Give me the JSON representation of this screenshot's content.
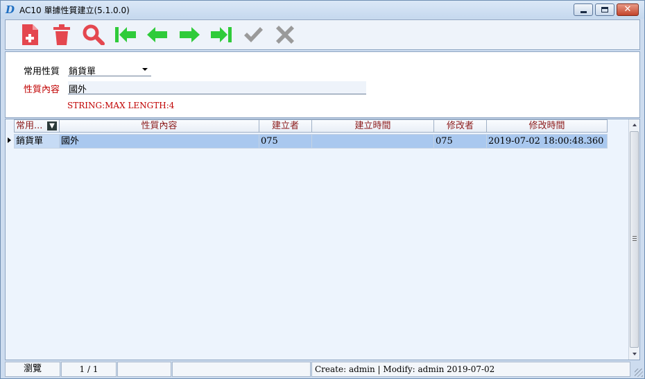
{
  "window": {
    "title": "AC10 單據性質建立(5.1.0.0)",
    "app_icon_glyph": "D"
  },
  "toolbar": {
    "buttons": [
      {
        "name": "new-document-icon",
        "color": "#e4474f"
      },
      {
        "name": "delete-trash-icon",
        "color": "#e4474f"
      },
      {
        "name": "search-magnifier-icon",
        "color": "#e4474f"
      },
      {
        "name": "first-record-icon",
        "color": "#2fcb3a"
      },
      {
        "name": "previous-record-icon",
        "color": "#2fcb3a"
      },
      {
        "name": "next-record-icon",
        "color": "#2fcb3a"
      },
      {
        "name": "last-record-icon",
        "color": "#2fcb3a"
      },
      {
        "name": "confirm-check-icon",
        "color": "#9a9a9a"
      },
      {
        "name": "cancel-x-icon",
        "color": "#9a9a9a"
      }
    ]
  },
  "form": {
    "type_label": "常用性質",
    "type_value": "銷貨單",
    "content_label": "性質內容",
    "content_value": "國外",
    "hint": "STRING:MAX LENGTH:4"
  },
  "grid": {
    "columns": [
      "常用...",
      "性質內容",
      "建立者",
      "建立時間",
      "修改者",
      "修改時間"
    ],
    "rows": [
      [
        "銷貨單",
        "國外",
        "075",
        "",
        "075",
        "2019-07-02 18:00:48.360"
      ]
    ],
    "selected_row": 0
  },
  "status": {
    "mode": "瀏覽",
    "page": "1 / 1",
    "blank1": "",
    "blank2": "",
    "audit": "Create: admin  | Modify: admin 2019-07-02"
  },
  "colors": {
    "accent_red": "#e4474f",
    "nav_green": "#2fcb3a",
    "disabled_gray": "#9a9a9a",
    "required_label": "#c00000",
    "selected_row": "#a9c8ef"
  }
}
